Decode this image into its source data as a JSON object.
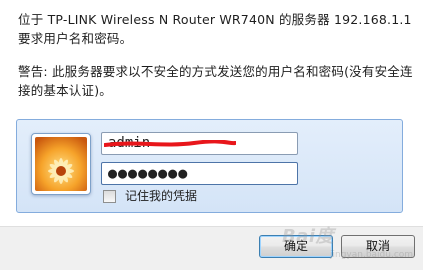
{
  "dialog": {
    "message": "位于 TP-LINK Wireless N Router WR740N 的服务器 192.168.1.1 要求用户名和密码。",
    "warning": "警告: 此服务器要求以不安全的方式发送您的用户名和密码(没有安全连接的基本认证)。"
  },
  "credentials": {
    "username_value": "admin",
    "password_value": "●●●●●●●●",
    "remember_label": "记住我的凭据",
    "remember_checked": false
  },
  "buttons": {
    "ok_label": "确定",
    "cancel_label": "取消"
  },
  "watermark": {
    "text": "Bai度",
    "sub": "jingyan.baidu.com"
  },
  "colors": {
    "credential_panel": "#dbe8f8",
    "panel_border": "#84acdd",
    "redaction_mark": "#e8161b"
  },
  "icons": {
    "user_tile": "flower-user-tile-icon"
  }
}
